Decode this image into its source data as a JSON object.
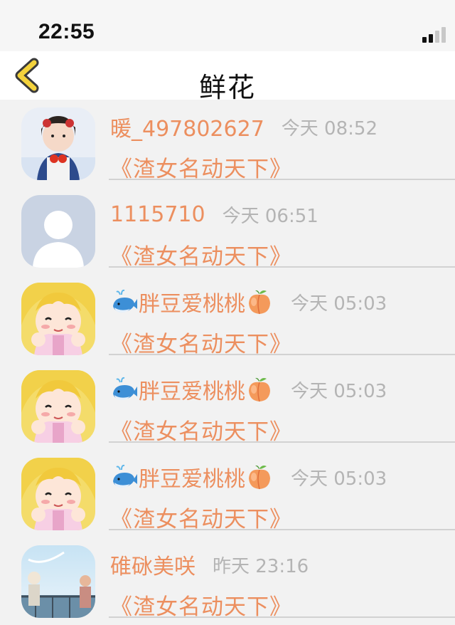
{
  "status": {
    "time": "22:55"
  },
  "nav": {
    "title": "鲜花"
  },
  "colors": {
    "accent": "#ec8f5f",
    "muted": "#b4b4b4",
    "back": "#f3d23c"
  },
  "items": [
    {
      "name": "暖_497802627",
      "time": "今天 08:52",
      "message": "《渣女名动天下》",
      "avatar": "girl-photo",
      "emoji_before": "",
      "emoji_after": ""
    },
    {
      "name": "1115710",
      "time": "今天 06:51",
      "message": "《渣女名动天下》",
      "avatar": "default-person",
      "emoji_before": "",
      "emoji_after": ""
    },
    {
      "name": "胖豆爱桃桃",
      "time": "今天 05:03",
      "message": "《渣女名动天下》",
      "avatar": "anime-girl",
      "emoji_before": "whale-icon",
      "emoji_after": "peach-icon"
    },
    {
      "name": "胖豆爱桃桃",
      "time": "今天 05:03",
      "message": "《渣女名动天下》",
      "avatar": "anime-girl",
      "emoji_before": "whale-icon",
      "emoji_after": "peach-icon"
    },
    {
      "name": "胖豆爱桃桃",
      "time": "今天 05:03",
      "message": "《渣女名动天下》",
      "avatar": "anime-girl",
      "emoji_before": "whale-icon",
      "emoji_after": "peach-icon"
    },
    {
      "name": "碓砯美咲",
      "time": "昨天 23:16",
      "message": "《渣女名动天下》",
      "avatar": "landscape-photo",
      "emoji_before": "",
      "emoji_after": ""
    }
  ]
}
